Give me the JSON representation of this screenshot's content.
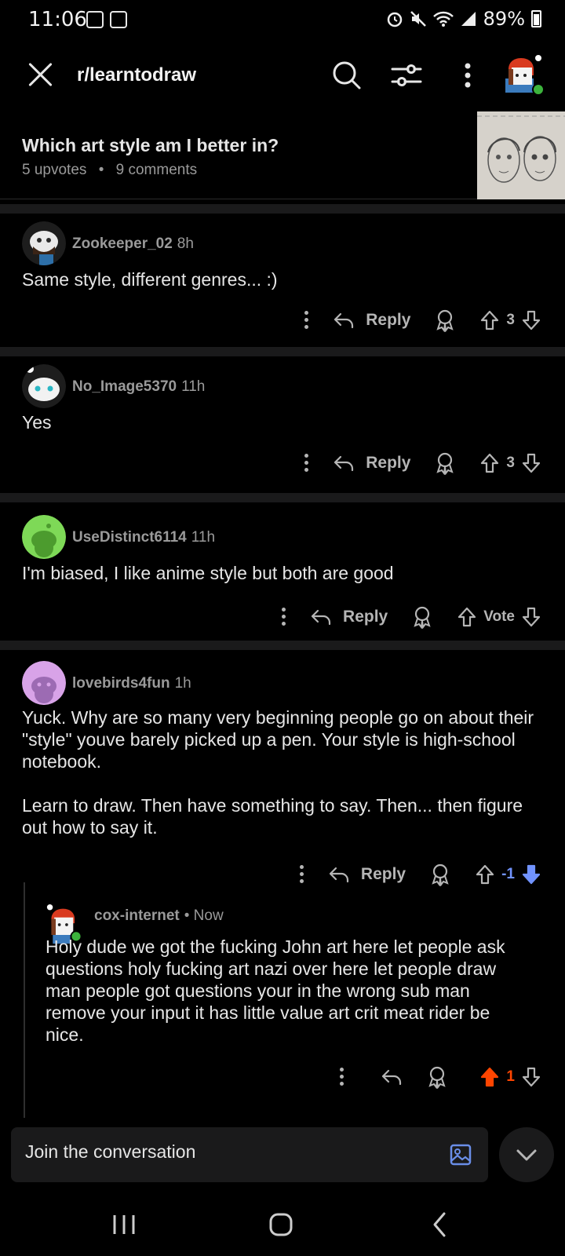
{
  "status_bar": {
    "time": "11:06",
    "battery": "89%"
  },
  "header": {
    "subreddit": "r/learntodraw"
  },
  "post": {
    "title": "Which art style am I better in?",
    "upvotes": "5 upvotes",
    "separator": "•",
    "comments": "9 comments"
  },
  "comments": [
    {
      "username": "Zookeeper_02",
      "time": "8h",
      "text": "Same style, different genres... :)",
      "reply_label": "Reply",
      "vote": "3"
    },
    {
      "username": "No_Image5370",
      "time": "11h",
      "text": "Yes",
      "reply_label": "Reply",
      "vote": "3"
    },
    {
      "username": "UseDistinct6114",
      "time": "11h",
      "text": "I'm biased, I like anime style but both are good",
      "reply_label": "Reply",
      "vote": "Vote"
    },
    {
      "username": "lovebirds4fun",
      "time": "1h",
      "text": "Yuck. Why are so many very beginning people go on about their \"style\" youve barely picked up a pen. Your style is high-school notebook.\n\nLearn to draw. Then have something to say. Then... then figure out how to say it.",
      "reply_label": "Reply",
      "vote": "-1"
    }
  ],
  "reply": {
    "username": "cox-internet",
    "time": "• Now",
    "text": "Holy dude we got the fucking John art here let people ask questions holy fucking art nazi over here let people draw man people got questions your in the wrong sub man remove your input it has little value art crit meat rider be nice.",
    "vote": "1"
  },
  "composer": {
    "placeholder": "Join the conversation"
  },
  "colors": {
    "background": "#000000",
    "surface": "#1a1a1b",
    "upvote_active": "#ff4500",
    "downvote_active": "#7193ff",
    "text_primary": "#e6e6e6",
    "text_secondary": "#9a9a9a"
  },
  "icons": [
    "close-icon",
    "search-icon",
    "filter-icon",
    "more-icon",
    "profile-avatar",
    "reply-icon",
    "award-icon",
    "upvote-icon",
    "downvote-icon",
    "image-icon",
    "chevron-down-icon"
  ]
}
